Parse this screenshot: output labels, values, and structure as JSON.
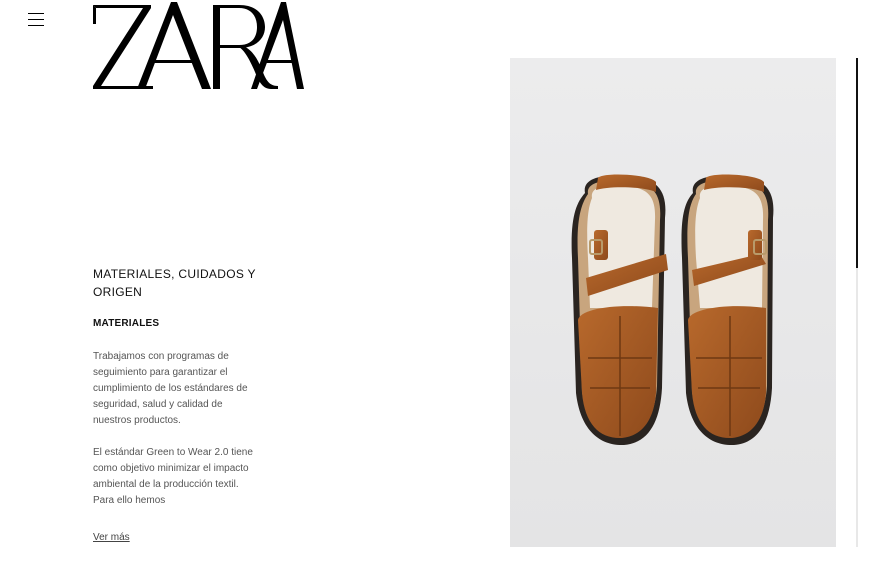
{
  "header": {
    "logo_text": "ZARA",
    "menu_icon": "hamburger-menu-icon"
  },
  "product_info": {
    "section_title": "MATERIALES, CUIDADOS Y ORIGEN",
    "subsection_title": "MATERIALES",
    "paragraphs": [
      "Trabajamos con programas de seguimiento para garantizar el cumplimiento de los estándares de seguridad, salud y calidad de nuestros productos.",
      "El estándar Green to Wear 2.0 tiene como objetivo minimizar el impacto ambiental de la producción textil. Para ello hemos"
    ],
    "ver_mas_label": "Ver más"
  },
  "product_image": {
    "subject": "brown leather fisherman sandals",
    "colors": {
      "leather": "#a55a24",
      "background": "#e8e8e9",
      "sole": "#2a2420"
    }
  },
  "scrollbar": {
    "position": 0.43
  }
}
